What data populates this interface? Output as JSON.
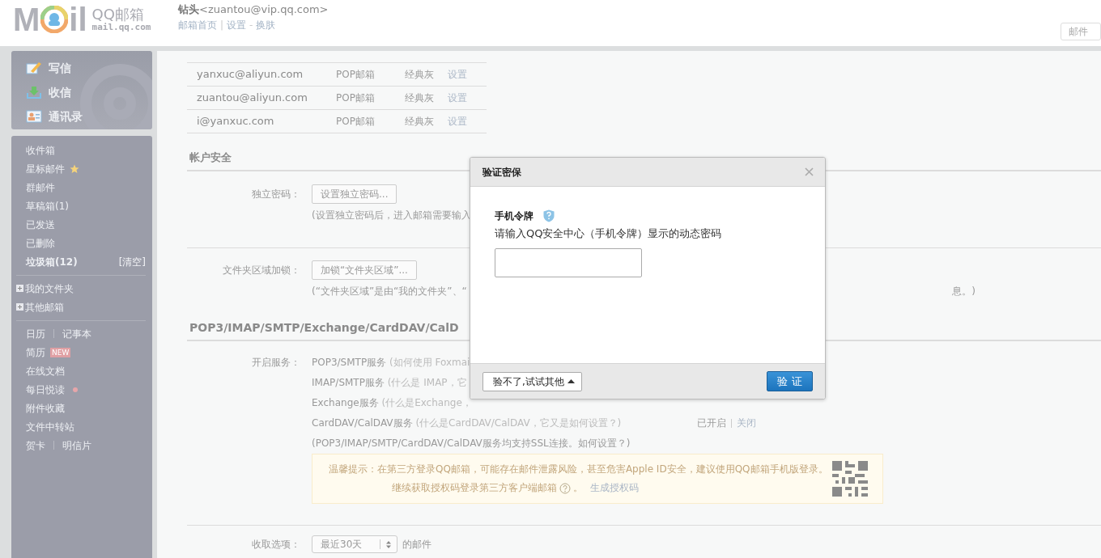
{
  "logo": {
    "left": "M",
    "right": "il",
    "name": "QQ邮箱",
    "domain": "mail.qq.com"
  },
  "user": {
    "name": "钻头",
    "email": "<zuantou@vip.qq.com>"
  },
  "nav": [
    {
      "kind": "link",
      "text": "邮箱首页"
    },
    {
      "kind": "sep",
      "text": "|"
    },
    {
      "kind": "link",
      "text": "设置"
    },
    {
      "kind": "sep",
      "text": "-"
    },
    {
      "kind": "link",
      "text": "换肤"
    }
  ],
  "search": {
    "placeholder": "邮件"
  },
  "sidebar": {
    "actions": [
      {
        "kind": "compose",
        "label": "写信"
      },
      {
        "kind": "receive",
        "label": "收信"
      },
      {
        "kind": "contacts",
        "label": "通讯录"
      }
    ],
    "folders": [
      {
        "label": "收件箱",
        "bold": false
      },
      {
        "label": "星标邮件",
        "bold": false,
        "starred": true
      },
      {
        "label": "群邮件",
        "bold": false
      },
      {
        "label": "草稿箱(1)",
        "bold": false
      },
      {
        "label": "已发送",
        "bold": false
      },
      {
        "label": "已删除",
        "bold": false
      },
      {
        "label": "垃圾箱(12)",
        "bold": true,
        "action": "[清空]"
      }
    ],
    "groups": [
      {
        "label": "我的文件夹",
        "expanded": false
      },
      {
        "label": "其他邮箱",
        "expanded": false
      }
    ],
    "apps": [
      {
        "items": [
          "日历",
          "记事本"
        ]
      },
      {
        "items": [
          "简历"
        ],
        "badge": "NEW"
      },
      {
        "items": [
          "在线文档"
        ]
      },
      {
        "items": [
          "每日悦读"
        ],
        "dot": true
      },
      {
        "items": [
          "附件收藏"
        ]
      },
      {
        "items": [
          "文件中转站"
        ]
      },
      {
        "items": [
          "贺卡",
          "明信片"
        ]
      }
    ]
  },
  "accounts": [
    {
      "email": "yanxuc@aliyun.com",
      "type": "POP邮箱",
      "skin": "经典灰",
      "action": "设置"
    },
    {
      "email": "zuantou@aliyun.com",
      "type": "POP邮箱",
      "skin": "经典灰",
      "action": "设置"
    },
    {
      "email": "i@yanxuc.com",
      "type": "POP邮箱",
      "skin": "经典灰",
      "action": "设置"
    }
  ],
  "security": {
    "title": "帐户安全",
    "rows": [
      {
        "label": "独立密码：",
        "button": "设置独立密码...",
        "note": "(设置独立密码后，进入邮箱需要输入"
      },
      {
        "label": "文件夹区域加锁：",
        "button": "加锁“文件夹区域”...",
        "note": "(“文件夹区域”是由“我的文件夹”、“",
        "note_tail": "息。)"
      }
    ]
  },
  "protocols": {
    "title": "POP3/IMAP/SMTP/Exchange/CardDAV/CalD",
    "label": "开启服务：",
    "services": [
      {
        "name": "POP3/SMTP服务",
        "hint": "(如何使用 Foxmai"
      },
      {
        "name": "IMAP/SMTP服务",
        "hint": "(什么是 IMAP，它"
      },
      {
        "name": "Exchange服务",
        "hint": "(什么是Exchange，"
      },
      {
        "name": "CardDAV/CalDAV服务",
        "hint": "(什么是CardDAV/CalDAV，它又是如何设置？)",
        "status": "已开启",
        "action": "关闭"
      }
    ],
    "note": "(POP3/IMAP/SMTP/CardDAV/CalDAV服务均支持SSL连接。如何设置？)",
    "tip": {
      "line1": "温馨提示：在第三方登录QQ邮箱，可能存在邮件泄露风险，甚至危害Apple ID安全，建议使用QQ邮箱手机版登录。",
      "line2": "继续获取授权码登录第三方客户端邮箱",
      "after_help": "。",
      "link": "生成授权码"
    }
  },
  "fetch": {
    "label": "收取选项：",
    "value": "最近30天",
    "suffix": "的邮件"
  },
  "dialog": {
    "title": "验证密保",
    "field_label": "手机令牌",
    "description": "请输入QQ安全中心（手机令牌）显示的动态密码",
    "alt_button": "验不了,试试其他",
    "confirm": "验 证"
  }
}
